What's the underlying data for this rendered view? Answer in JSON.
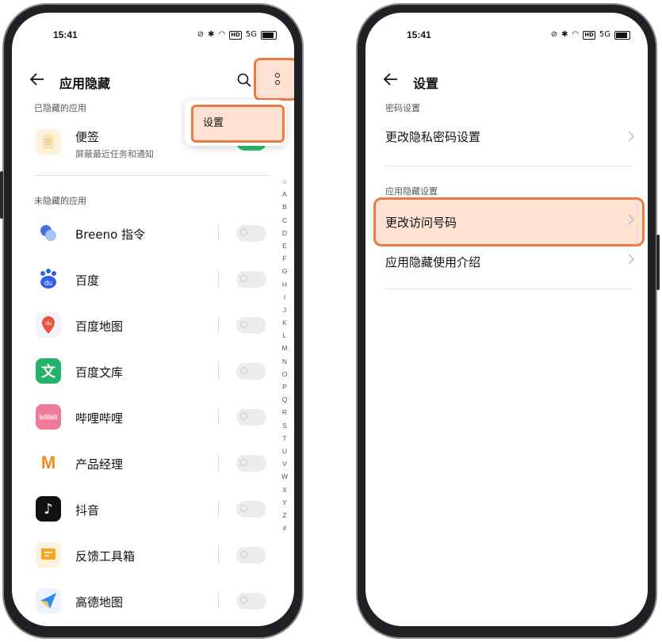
{
  "status_bar": {
    "time": "15:41",
    "icons": [
      "dnd-icon",
      "bluetooth-icon",
      "wifi-icon",
      "hd-icon",
      "5g-signal-icon",
      "battery-icon"
    ],
    "hd_text": "HD",
    "signal_text": "5G"
  },
  "left": {
    "title": "应用隐藏",
    "menu_item": "设置",
    "hidden_section": "已隐藏的应用",
    "hidden_apps": [
      {
        "name": "便签",
        "sub": "屏蔽最近任务和通知",
        "icon": "notes-icon",
        "toggle_on": true
      }
    ],
    "visible_section": "未隐藏的应用",
    "apps": [
      {
        "name": "Breeno 指令",
        "icon": "breeno-icon",
        "toggle_on": false
      },
      {
        "name": "百度",
        "icon": "baidu-icon",
        "icon_text": "du",
        "toggle_on": false
      },
      {
        "name": "百度地图",
        "icon": "baidu-map-icon",
        "icon_text": "du",
        "toggle_on": false
      },
      {
        "name": "百度文库",
        "icon": "baidu-wenku-icon",
        "icon_text": "文",
        "toggle_on": false
      },
      {
        "name": "哔哩哔哩",
        "icon": "bilibili-icon",
        "icon_text": "bilibili",
        "toggle_on": false
      },
      {
        "name": "产品经理",
        "icon": "pm-icon",
        "icon_text": "M",
        "toggle_on": false
      },
      {
        "name": "抖音",
        "icon": "douyin-icon",
        "icon_text": "♪",
        "toggle_on": false
      },
      {
        "name": "反馈工具箱",
        "icon": "feedback-icon",
        "toggle_on": false
      },
      {
        "name": "高德地图",
        "icon": "amap-icon",
        "toggle_on": false
      }
    ],
    "index_letters": [
      "☆",
      "A",
      "B",
      "C",
      "D",
      "E",
      "F",
      "G",
      "H",
      "I",
      "J",
      "K",
      "L",
      "M",
      "N",
      "O",
      "P",
      "Q",
      "R",
      "S",
      "T",
      "U",
      "V",
      "W",
      "X",
      "Y",
      "Z",
      "#"
    ]
  },
  "right": {
    "title": "设置",
    "password_section": "密码设置",
    "change_privacy_password": "更改隐私密码设置",
    "hide_section": "应用隐藏设置",
    "change_access_code": "更改访问号码",
    "intro": "应用隐藏使用介绍"
  },
  "colors": {
    "highlight_border": "#ee7b40",
    "highlight_fill": "#fde1d3",
    "toggle_on": "#2fbf71"
  }
}
